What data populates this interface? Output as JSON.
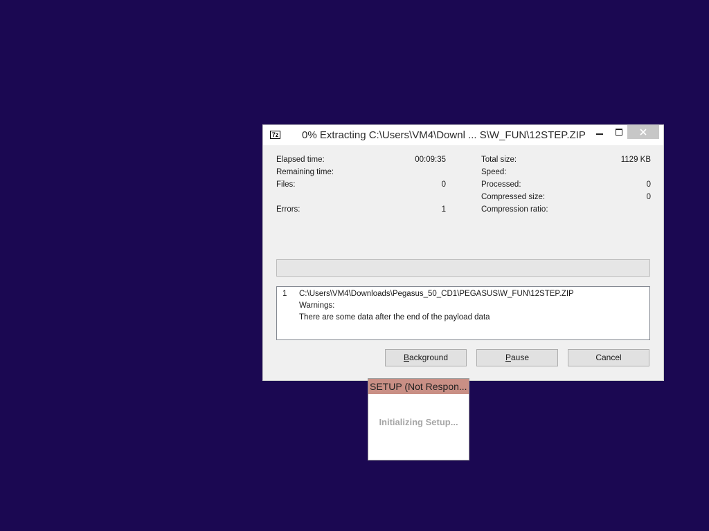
{
  "zip_window": {
    "app_icon_text": "7z",
    "title": "0% Extracting C:\\Users\\VM4\\Downl ... S\\W_FUN\\12STEP.ZIP",
    "stats_left": {
      "elapsed_label": "Elapsed time:",
      "elapsed_value": "00:09:35",
      "remaining_label": "Remaining time:",
      "remaining_value": "",
      "files_label": "Files:",
      "files_value": "0",
      "errors_label": "Errors:",
      "errors_value": "1"
    },
    "stats_right": {
      "total_size_label": "Total size:",
      "total_size_value": "1129 KB",
      "speed_label": "Speed:",
      "speed_value": "",
      "processed_label": "Processed:",
      "processed_value": "0",
      "compressed_size_label": "Compressed size:",
      "compressed_size_value": "0",
      "compression_ratio_label": "Compression ratio:",
      "compression_ratio_value": ""
    },
    "progress_fraction": 0,
    "messages": {
      "index": "1",
      "path": "C:\\Users\\VM4\\Downloads\\Pegasus_50_CD1\\PEGASUS\\W_FUN\\12STEP.ZIP",
      "warning_header": "Warnings:",
      "warning_text": "There are some data after the end of the payload data"
    },
    "buttons": {
      "background_label": "Background",
      "pause_label": "Pause",
      "cancel_label": "Cancel"
    }
  },
  "setup_window": {
    "title": "SETUP (Not Respon...",
    "status": "Initializing Setup..."
  },
  "colors": {
    "desktop_background": "#1b0852",
    "setup_titlebar": "#c98f85",
    "progress_fill": "#06b025"
  }
}
